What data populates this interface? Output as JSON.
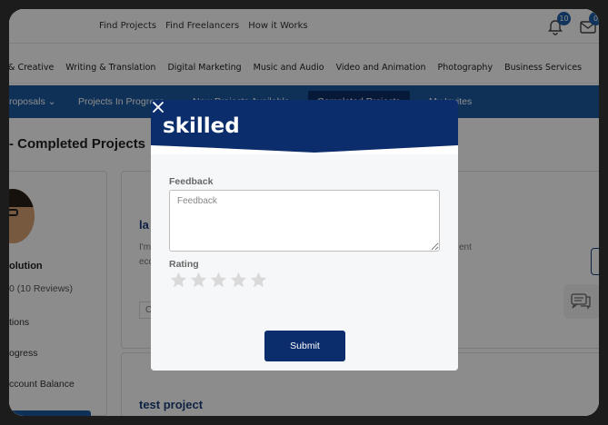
{
  "topnav": {
    "links": [
      "Find Projects",
      "Find Freelancers",
      "How it Works"
    ],
    "notifications_count": "10",
    "messages_count": "0"
  },
  "categories": [
    "n & Creative",
    "Writing & Translation",
    "Digital Marketing",
    "Music and Audio",
    "Video and Animation",
    "Photography",
    "Business Services"
  ],
  "tabs": {
    "proposals": "roposals",
    "in_progress": "Projects In Progress",
    "new_available": "New Projects Available",
    "completed": "Completed Projects",
    "my_invites": "My Invites"
  },
  "page": {
    "title": "- Completed Projects"
  },
  "profile": {
    "name": "olution",
    "reviews": "0 (10 Reviews)",
    "menu": [
      "tions",
      "ogress",
      "ccount Balance"
    ]
  },
  "projects": [
    {
      "title": "la",
      "text_1": "I'm",
      "text_2": "ecc",
      "tail": "ent",
      "code": "C"
    },
    {
      "title": "test project"
    }
  ],
  "modal": {
    "logo_text": "skilled",
    "feedback_label": "Feedback",
    "feedback_placeholder": "Feedback",
    "feedback_value": "",
    "rating_label": "Rating",
    "rating_value": 0,
    "rating_max": 5,
    "submit_label": "Submit",
    "colors": {
      "header": "#0b2d6b",
      "accent": "#1d5aa0",
      "star_empty": "#d9d9d9"
    }
  }
}
